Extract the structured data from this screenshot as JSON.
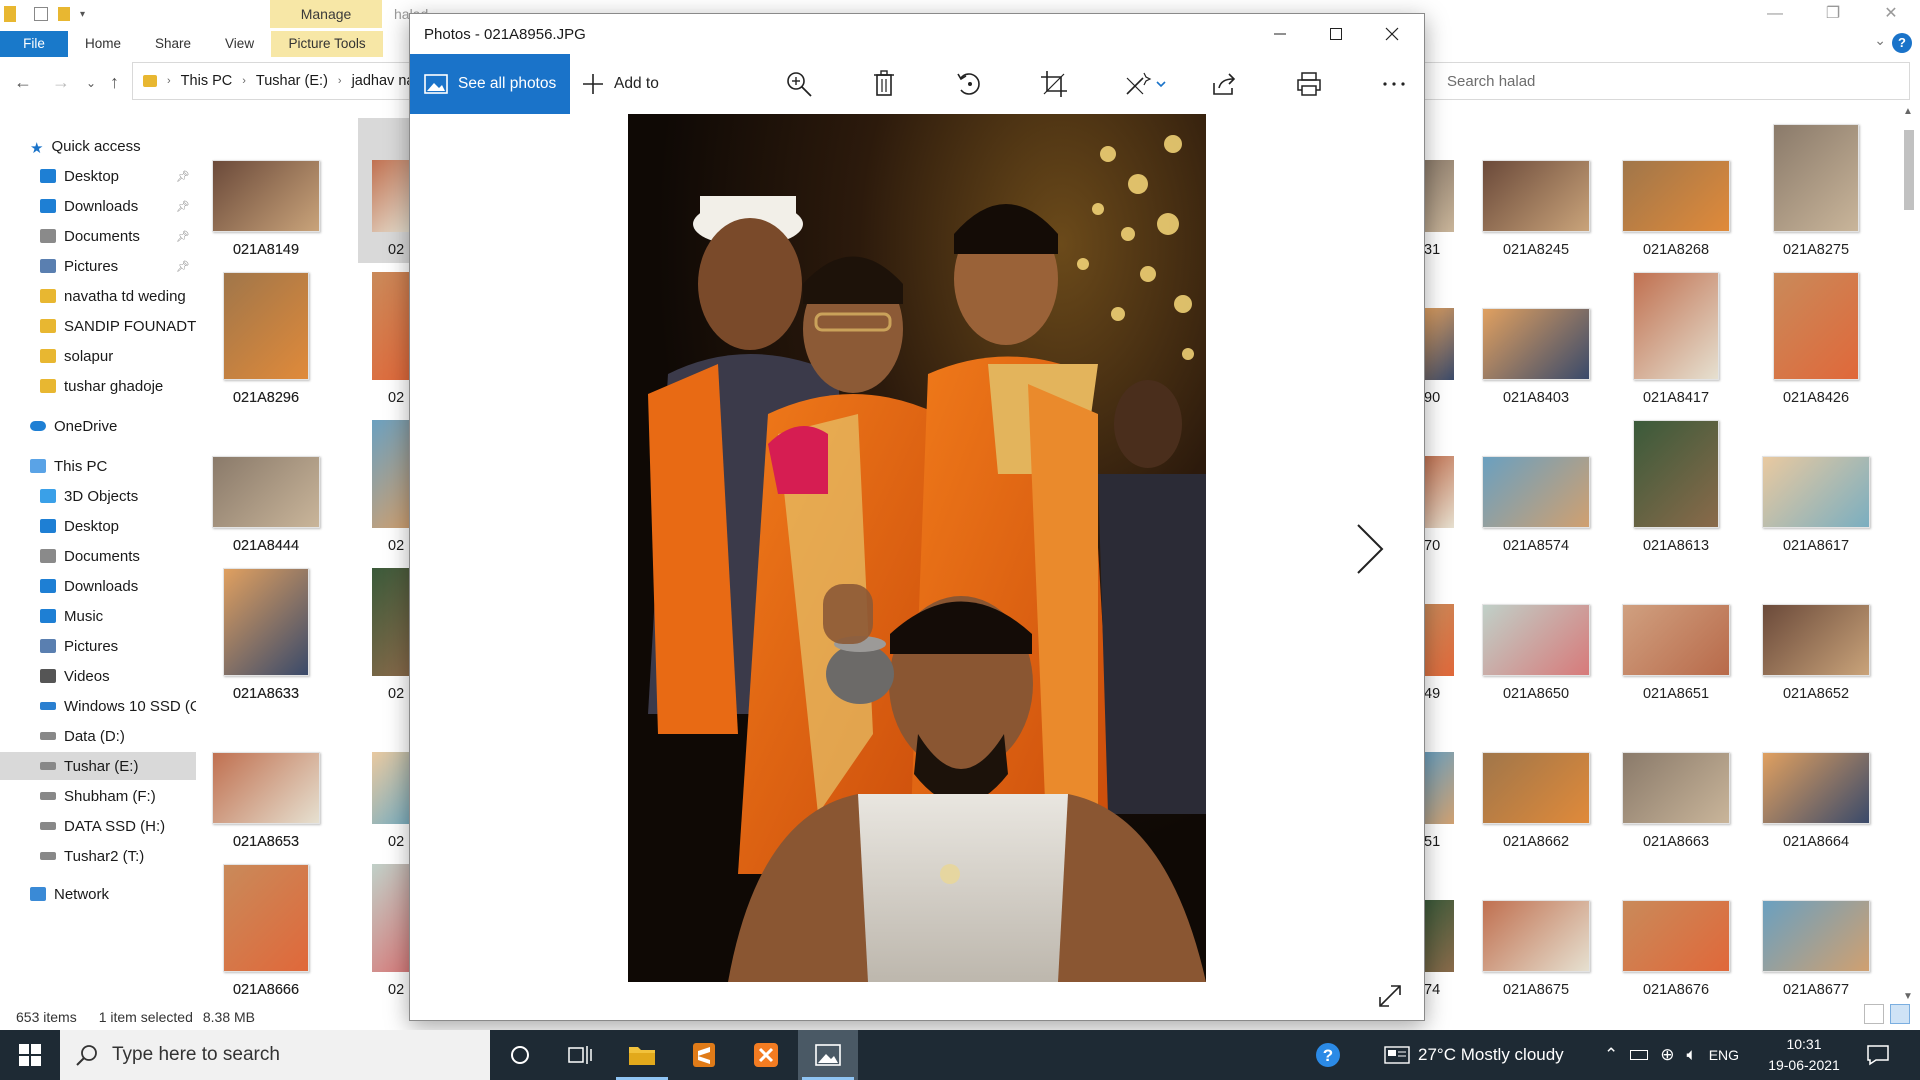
{
  "explorer": {
    "manage_tab": "Manage",
    "window_title_partial": "halad",
    "tabs": [
      "File",
      "Home",
      "Share",
      "View",
      "Picture Tools"
    ],
    "breadcrumb": [
      "This PC",
      "Tushar (E:)",
      "jadhav na"
    ],
    "search_placeholder": "Search halad",
    "nav": {
      "quick_access": "Quick access",
      "quick_items": [
        "Desktop",
        "Downloads",
        "Documents",
        "Pictures",
        "navatha td weding",
        "SANDIP FOUNADTI",
        "solapur",
        "tushar ghadoje"
      ],
      "onedrive": "OneDrive",
      "this_pc": "This PC",
      "pc_items": [
        "3D Objects",
        "Desktop",
        "Documents",
        "Downloads",
        "Music",
        "Pictures",
        "Videos",
        "Windows 10 SSD (C",
        "Data (D:)",
        "Tushar (E:)",
        "Shubham (F:)",
        "DATA SSD (H:)",
        "Tushar2 (T:)"
      ],
      "network": "Network"
    },
    "left_thumbs": [
      "021A8149",
      "021A8296",
      "021A8444",
      "021A8633",
      "021A8653",
      "021A8666"
    ],
    "left_partial": [
      "02",
      "02",
      "02",
      "02",
      "02",
      "02"
    ],
    "right_partial": [
      "31",
      "90",
      "70",
      "49",
      "51",
      "74"
    ],
    "right_thumbs": [
      [
        "021A8245",
        "021A8268",
        "021A8275"
      ],
      [
        "021A8403",
        "021A8417",
        "021A8426"
      ],
      [
        "021A8574",
        "021A8613",
        "021A8617"
      ],
      [
        "021A8650",
        "021A8651",
        "021A8652"
      ],
      [
        "021A8662",
        "021A8663",
        "021A8664"
      ],
      [
        "021A8675",
        "021A8676",
        "021A8677"
      ]
    ],
    "status": {
      "count": "653 items",
      "selected": "1 item selected",
      "size": "8.38 MB"
    }
  },
  "photos": {
    "title": "Photos - 021A8956.JPG",
    "see_all": "See all photos",
    "add_to": "Add to"
  },
  "taskbar": {
    "search_placeholder": "Type here to search",
    "weather": "27°C  Mostly cloudy",
    "lang": "ENG",
    "time": "10:31",
    "date": "19-06-2021"
  },
  "colors": {
    "accent": "#1a73c9",
    "manage_band": "#f7e7a6",
    "taskbar": "#1e2a34"
  }
}
